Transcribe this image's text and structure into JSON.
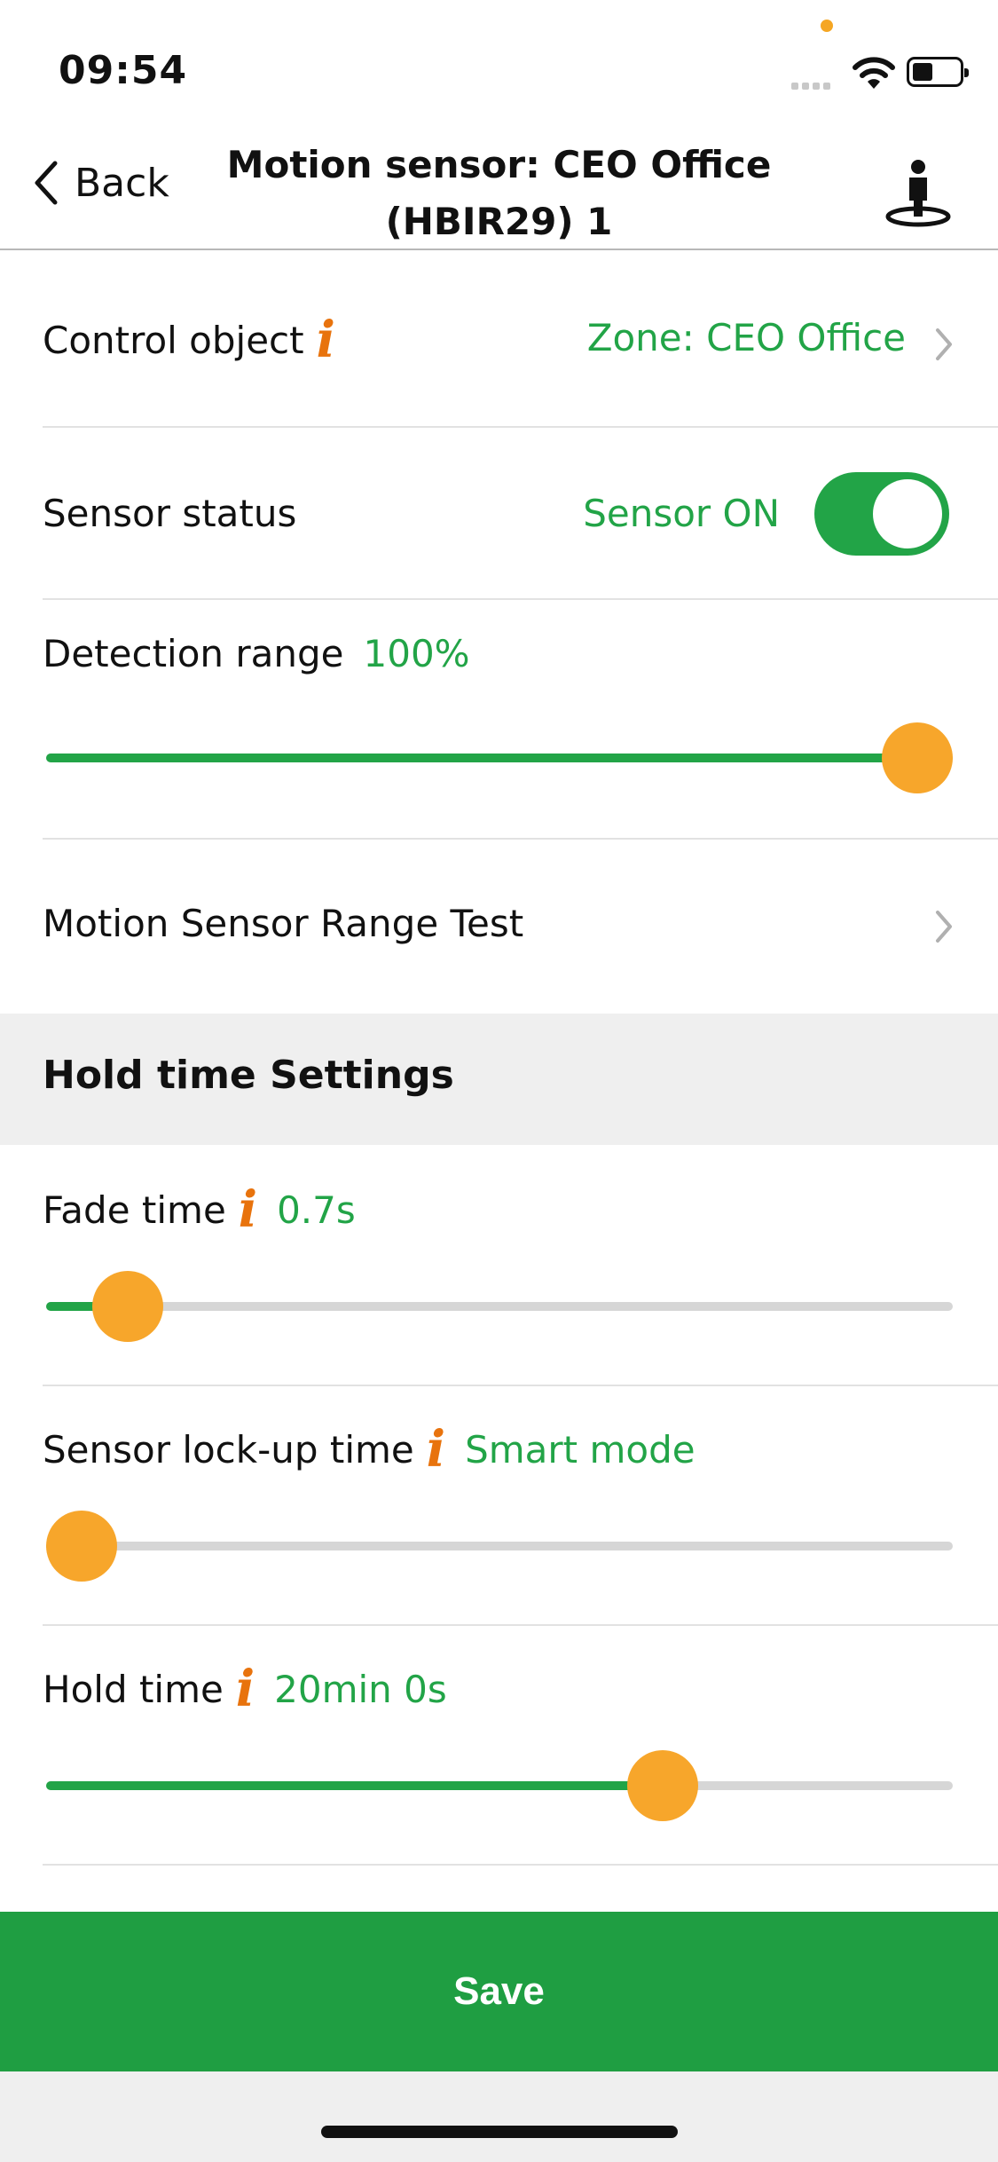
{
  "status_bar": {
    "time": "09:54"
  },
  "nav": {
    "back_label": "Back",
    "title": "Motion sensor: CEO Office (HBIR29) 1"
  },
  "control_object": {
    "label": "Control object",
    "value": "Zone: CEO Office"
  },
  "sensor_status": {
    "label": "Sensor status",
    "value": "Sensor ON",
    "on": true
  },
  "detection_range": {
    "label": "Detection range",
    "value": "100%",
    "level_percent": 100
  },
  "range_test": {
    "label": "Motion Sensor Range Test"
  },
  "hold_section": {
    "title": "Hold time Settings"
  },
  "fade_time": {
    "label": "Fade time",
    "value": "0.7s",
    "level_percent": 9
  },
  "lockup_time": {
    "label": "Sensor lock-up time",
    "value": "Smart mode",
    "level_percent": 3
  },
  "hold_time": {
    "label": "Hold time",
    "value": "20min 0s",
    "level_percent": 68
  },
  "save": {
    "label": "Save"
  },
  "icons": {
    "info": "info-icon",
    "chevron": "chevron-right-icon",
    "person": "person-on-spot-icon"
  },
  "colors": {
    "accent_green": "#22a447",
    "thumb_orange": "#f7a62b",
    "info_orange": "#e8730d"
  }
}
